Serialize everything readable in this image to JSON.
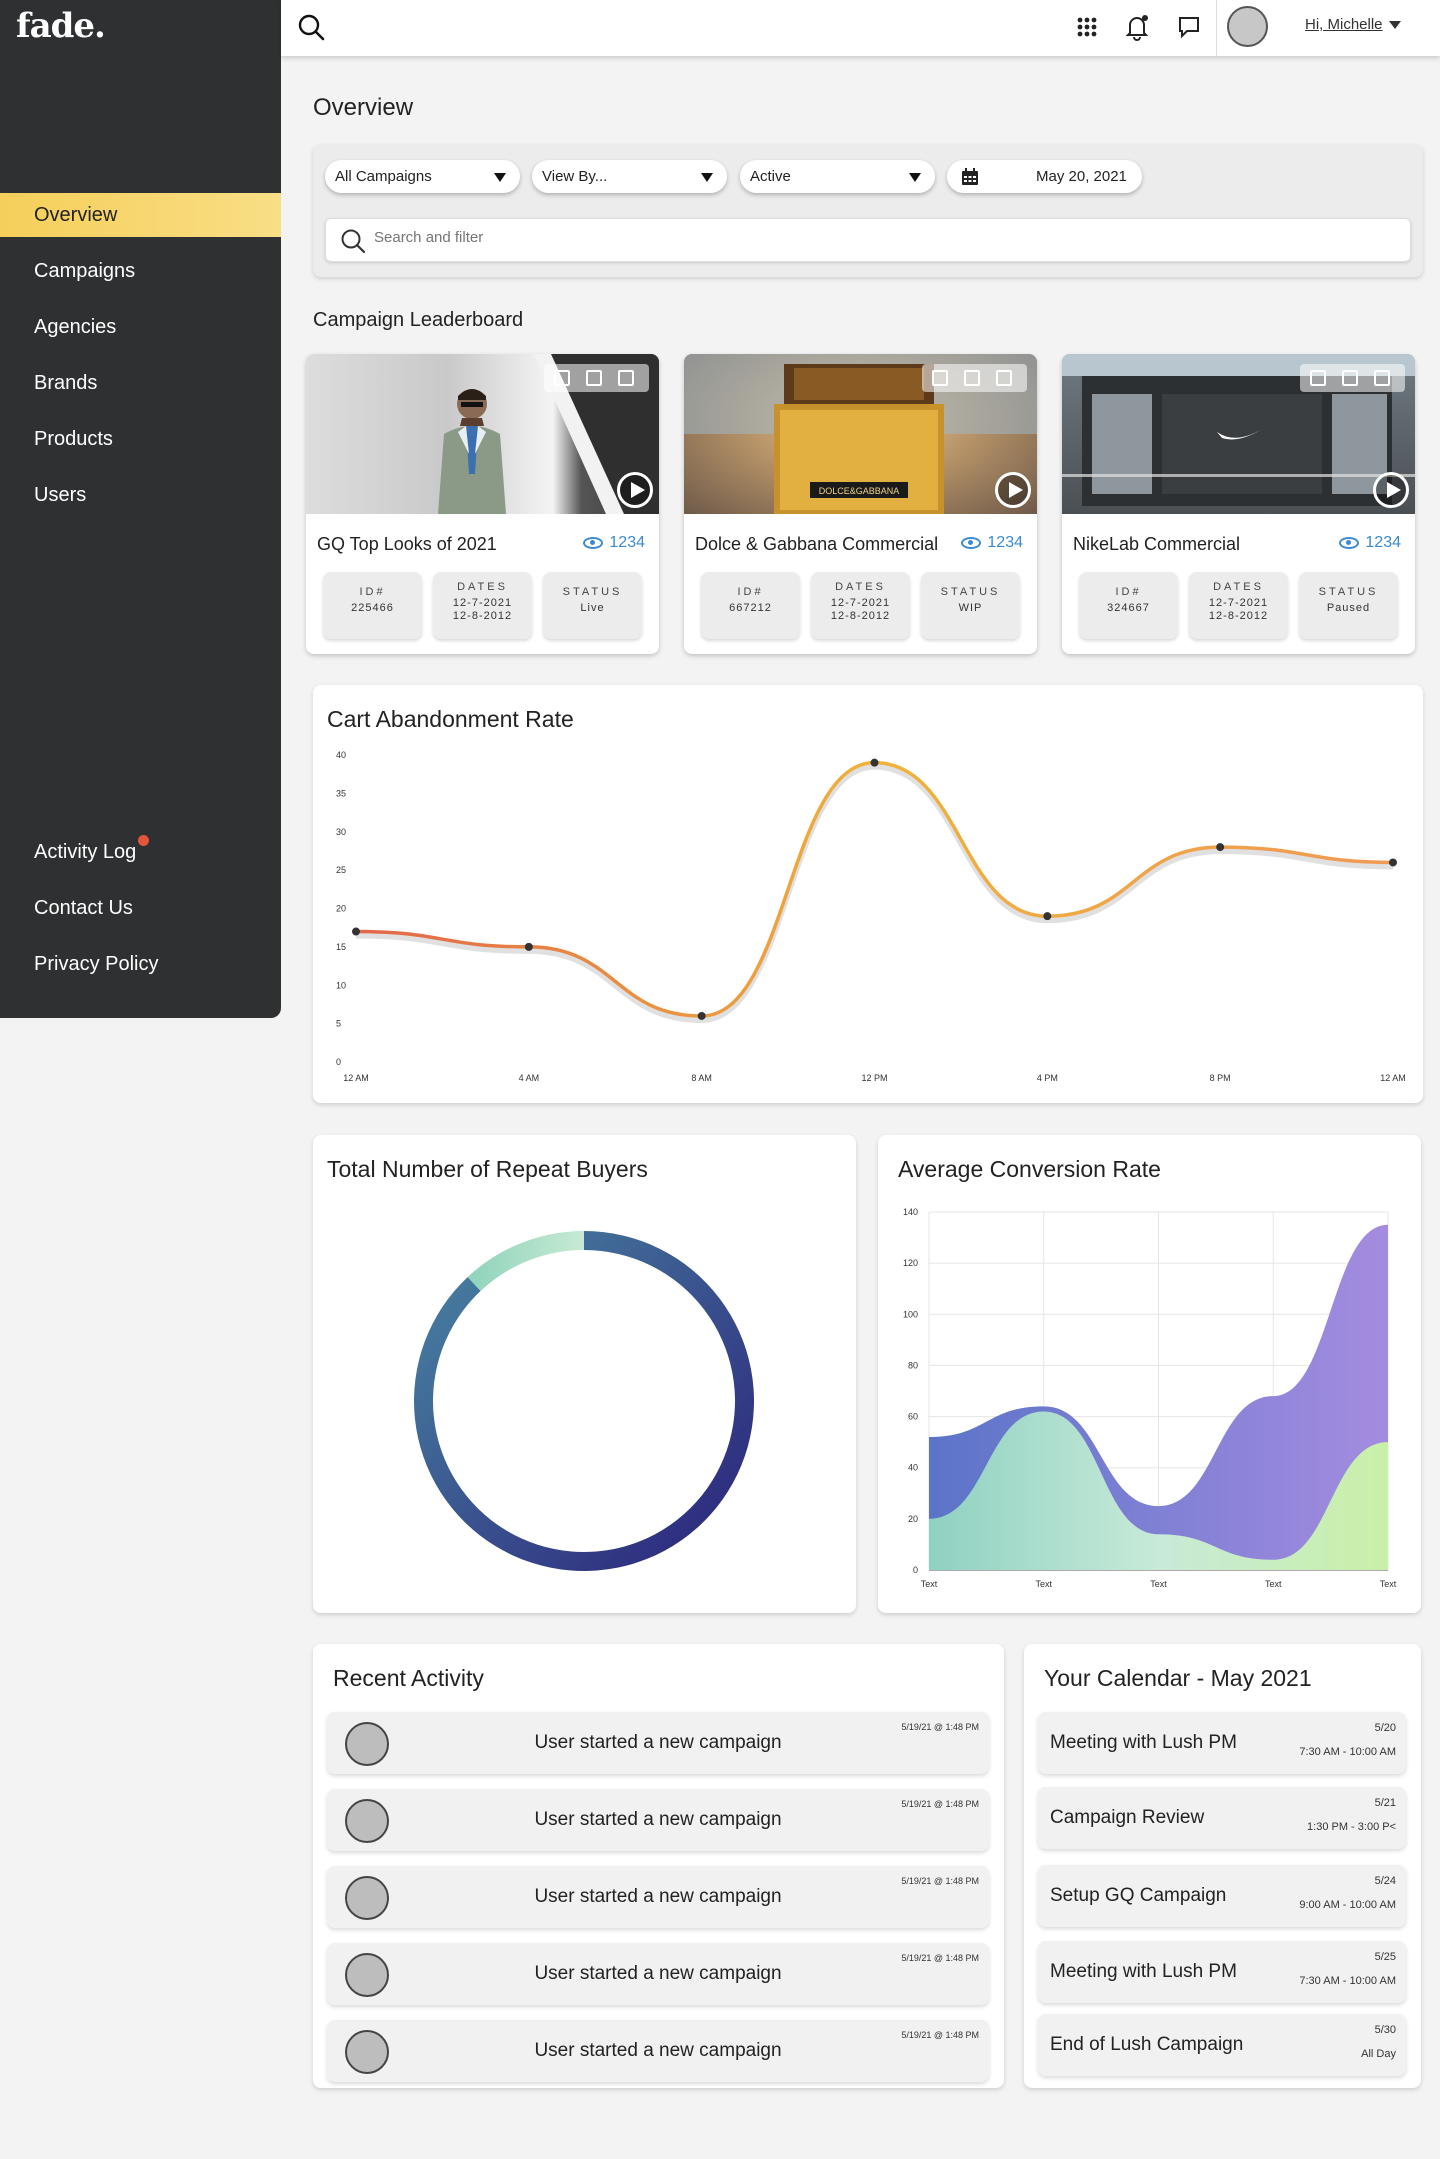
{
  "app": {
    "logo": "fade."
  },
  "sidebar": {
    "items": [
      {
        "label": "Overview",
        "active": true
      },
      {
        "label": "Campaigns"
      },
      {
        "label": "Agencies"
      },
      {
        "label": "Brands"
      },
      {
        "label": "Products"
      },
      {
        "label": "Users"
      }
    ],
    "footer_items": [
      {
        "label": "Activity Log",
        "badge": true
      },
      {
        "label": "Contact Us"
      },
      {
        "label": "Privacy Policy"
      }
    ]
  },
  "topbar": {
    "greeting": "Hi, Michelle"
  },
  "page": {
    "title": "Overview",
    "leaderboard_title": "Campaign Leaderboard"
  },
  "filters": {
    "campaigns": "All Campaigns",
    "view_by": "View By...",
    "status": "Active",
    "date": "May 20, 2021",
    "search_placeholder": "Search and filter"
  },
  "campaigns": [
    {
      "title": "GQ Top Looks of 2021",
      "views": "1234",
      "id_label": "ID#",
      "id": "225466",
      "dates_label": "DATES",
      "dates": [
        "12-7-2021",
        "12-8-2012"
      ],
      "status_label": "STATUS",
      "status": "Live"
    },
    {
      "title": "Dolce & Gabbana Commercial",
      "views": "1234",
      "id_label": "ID#",
      "id": "667212",
      "dates_label": "DATES",
      "dates": [
        "12-7-2021",
        "12-8-2012"
      ],
      "status_label": "STATUS",
      "status": "WIP",
      "brand_text": "DOLCE&GABBANA"
    },
    {
      "title": "NikeLab Commercial",
      "views": "1234",
      "id_label": "ID#",
      "id": "324667",
      "dates_label": "DATES",
      "dates": [
        "12-7-2021",
        "12-8-2012"
      ],
      "status_label": "STATUS",
      "status": "Paused"
    }
  ],
  "colors": {
    "accent": "#f6cf5a",
    "sidebar": "#2e3031",
    "link": "#3a8bd0",
    "badge": "#e5553a"
  },
  "charts": {
    "cart_title": "Cart Abandonment Rate",
    "buyers_title": "Total Number of Repeat Buyers",
    "conversion_title": "Average Conversion Rate"
  },
  "chart_data": [
    {
      "type": "line",
      "title": "Cart Abandonment Rate",
      "categories": [
        "12 AM",
        "4 AM",
        "8 AM",
        "12 PM",
        "4 PM",
        "8 PM",
        "12 AM"
      ],
      "values": [
        17,
        15,
        6,
        39,
        19,
        28,
        26
      ],
      "ylim": [
        0,
        40
      ],
      "yticks": [
        0,
        5,
        10,
        15,
        20,
        25,
        30,
        35,
        40
      ]
    },
    {
      "type": "pie",
      "title": "Total Number of Repeat Buyers",
      "values": [
        88,
        12
      ]
    },
    {
      "type": "area",
      "title": "Average Conversion Rate",
      "categories": [
        "Text",
        "Text",
        "Text",
        "Text",
        "Text"
      ],
      "series": [
        {
          "values": [
            52,
            64,
            25,
            68,
            135
          ]
        },
        {
          "values": [
            20,
            62,
            14,
            4,
            50
          ]
        }
      ],
      "ylim": [
        0,
        140
      ],
      "yticks": [
        0,
        20,
        40,
        60,
        80,
        100,
        120,
        140
      ]
    }
  ],
  "activity": {
    "title": "Recent Activity",
    "items": [
      {
        "text": "User started a new campaign",
        "time": "5/19/21 @ 1:48 PM"
      },
      {
        "text": "User started a new campaign",
        "time": "5/19/21 @ 1:48 PM"
      },
      {
        "text": "User started a new campaign",
        "time": "5/19/21 @ 1:48 PM"
      },
      {
        "text": "User started a new campaign",
        "time": "5/19/21 @ 1:48 PM"
      },
      {
        "text": "User started a new campaign",
        "time": "5/19/21 @ 1:48 PM"
      }
    ]
  },
  "calendar": {
    "title": "Your Calendar - May 2021",
    "items": [
      {
        "event": "Meeting with Lush PM",
        "date": "5/20",
        "time": "7:30 AM - 10:00 AM"
      },
      {
        "event": "Campaign Review",
        "date": "5/21",
        "time": "1:30 PM - 3:00 P<"
      },
      {
        "event": "Setup GQ Campaign",
        "date": "5/24",
        "time": "9:00 AM - 10:00 AM"
      },
      {
        "event": "Meeting with Lush PM",
        "date": "5/25",
        "time": "7:30 AM - 10:00 AM"
      },
      {
        "event": "End of Lush Campaign",
        "date": "5/30",
        "time": "All Day"
      }
    ]
  }
}
